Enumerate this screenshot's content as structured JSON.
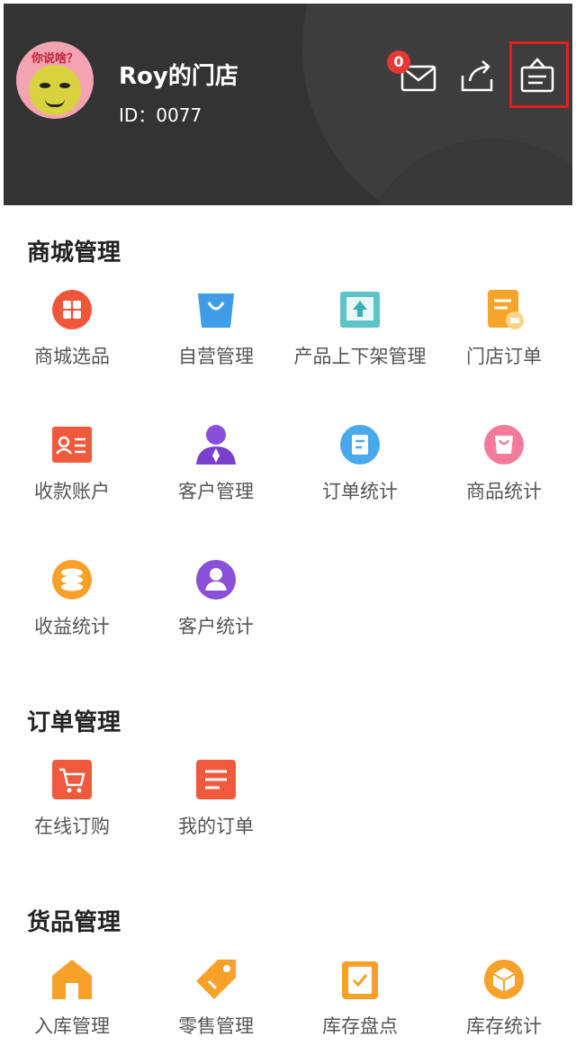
{
  "profile": {
    "name": "Roy的门店",
    "id_text": "ID：0077",
    "avatar_caption": "你说啥？"
  },
  "header": {
    "mail_badge": "0",
    "icons": [
      "mail-icon",
      "share-icon",
      "store-icon"
    ]
  },
  "sections": [
    {
      "title": "商城管理",
      "items": [
        {
          "label": "商城选品",
          "icon": "grid-icon"
        },
        {
          "label": "自营管理",
          "icon": "bag-icon"
        },
        {
          "label": "产品上下架管理",
          "icon": "upload-box-icon"
        },
        {
          "label": "门店订单",
          "icon": "order-doc-icon"
        },
        {
          "label": "收款账户",
          "icon": "account-card-icon"
        },
        {
          "label": "客户管理",
          "icon": "person-icon"
        },
        {
          "label": "订单统计",
          "icon": "order-stat-icon"
        },
        {
          "label": "商品统计",
          "icon": "product-stat-icon"
        },
        {
          "label": "收益统计",
          "icon": "coin-stack-icon"
        },
        {
          "label": "客户统计",
          "icon": "customer-stat-icon"
        }
      ]
    },
    {
      "title": "订单管理",
      "items": [
        {
          "label": "在线订购",
          "icon": "cart-icon"
        },
        {
          "label": "我的订单",
          "icon": "list-icon"
        }
      ]
    },
    {
      "title": "货品管理",
      "items": [
        {
          "label": "入库管理",
          "icon": "warehouse-icon"
        },
        {
          "label": "零售管理",
          "icon": "tag-icon"
        },
        {
          "label": "库存盘点",
          "icon": "clipboard-check-icon"
        },
        {
          "label": "库存统计",
          "icon": "cube-icon"
        }
      ]
    }
  ]
}
